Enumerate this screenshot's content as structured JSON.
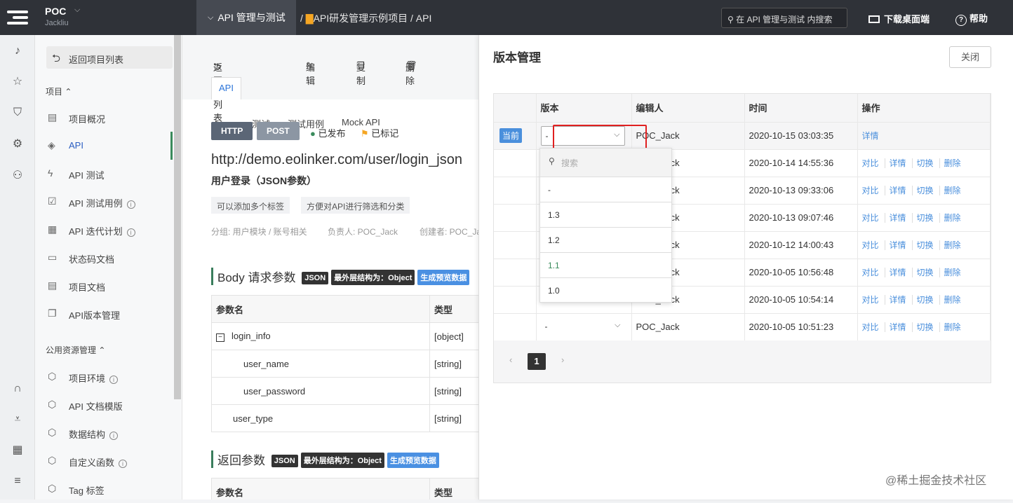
{
  "topbar": {
    "project_name": "POC",
    "user_name": "Jackliu",
    "active_nav": "API 管理与测试",
    "breadcrumb_sep": "/",
    "breadcrumb_project": "API研发管理示例项目",
    "breadcrumb_tail": "/ API",
    "search_placeholder": "在 API 管理与测试 内搜索",
    "download_label": "下载桌面端",
    "help_label": "帮助"
  },
  "sidebar": {
    "back_label": "返回项目列表",
    "section_project": "项目",
    "section_public": "公用资源管理",
    "items": [
      {
        "label": "项目概况",
        "icon": "overview-icon"
      },
      {
        "label": "API",
        "icon": "tag-icon"
      },
      {
        "label": "API 测试",
        "icon": "bolt-icon"
      },
      {
        "label": "API 测试用例",
        "icon": "checklist-icon"
      },
      {
        "label": "API 迭代计划",
        "icon": "calendar-icon"
      },
      {
        "label": "状态码文档",
        "icon": "document-icon"
      },
      {
        "label": "项目文档",
        "icon": "doc-list-icon"
      },
      {
        "label": "API版本管理",
        "icon": "versions-icon"
      }
    ],
    "public_items": [
      {
        "label": "项目环境",
        "icon": "cube-icon"
      },
      {
        "label": "API 文档模版",
        "icon": "cube-icon"
      },
      {
        "label": "数据结构",
        "icon": "cube-icon"
      },
      {
        "label": "自定义函数",
        "icon": "cube-icon"
      },
      {
        "label": "Tag 标签",
        "icon": "cube-icon"
      }
    ]
  },
  "main": {
    "toolbar": {
      "back": "返回API列表",
      "edit": "编辑",
      "copy": "复制",
      "delete": "删除"
    },
    "tabs": [
      "API",
      "测试",
      "测试用例",
      "Mock API"
    ],
    "protocol": "HTTP",
    "method": "POST",
    "status": "已发布",
    "flag": "已标记",
    "url": "http://demo.eolinker.com/user/login_json",
    "title": "用户登录（JSON参数）",
    "tags": [
      "可以添加多个标签",
      "方便对API进行筛选和分类"
    ],
    "meta_group": "分组: 用户模块 / 账号相关",
    "meta_owner": "负责人: POC_Jack",
    "meta_creator": "创建者: POC_Jack",
    "body_title": "Body 请求参数",
    "return_title": "返回参数",
    "pill_json": "JSON",
    "pill_struct": "最外层结构为：Object",
    "pill_gen": "生成预览数据",
    "param_header": [
      "参数名",
      "类型"
    ],
    "params": [
      {
        "name": "login_info",
        "type": "[object]"
      },
      {
        "name": "user_name",
        "type": "[string]"
      },
      {
        "name": "user_password",
        "type": "[string]"
      },
      {
        "name": "user_type",
        "type": "[string]"
      }
    ]
  },
  "panel": {
    "title": "版本管理",
    "close": "关闭",
    "headers": [
      "",
      "版本",
      "编辑人",
      "时间",
      "操作"
    ],
    "current_label": "当前",
    "rows": [
      {
        "version": "-",
        "editor": "POC_Jack",
        "time": "2020-10-15 03:03:35"
      },
      {
        "version": "-",
        "editor": "POC_Jack",
        "time": "2020-10-14 14:55:36"
      },
      {
        "version": "-",
        "editor": "POC_Jack",
        "time": "2020-10-13 09:33:06"
      },
      {
        "version": "-",
        "editor": "POC_Jack",
        "time": "2020-10-13 09:07:46"
      },
      {
        "version": "-",
        "editor": "POC_Jack",
        "time": "2020-10-12 14:00:43"
      },
      {
        "version": "-",
        "editor": "POC_Jack",
        "time": "2020-10-05 10:56:48"
      },
      {
        "version": "-",
        "editor": "POC_Jack",
        "time": "2020-10-05 10:54:14"
      },
      {
        "version": "-",
        "editor": "POC_Jack",
        "time": "2020-10-05 10:51:23"
      }
    ],
    "ops": {
      "compare": "对比",
      "detail": "详情",
      "switch": "切换",
      "delete": "删除"
    },
    "page": "1",
    "dropdown": {
      "search_placeholder": "搜索",
      "options": [
        "-",
        "1.3",
        "1.2",
        "1.1",
        "1.0"
      ]
    }
  },
  "watermark": "@稀土掘金技术社区",
  "colors": {
    "accent": "#4a8fdc",
    "highlight": "#e02020",
    "topbar": "#2f3238"
  }
}
